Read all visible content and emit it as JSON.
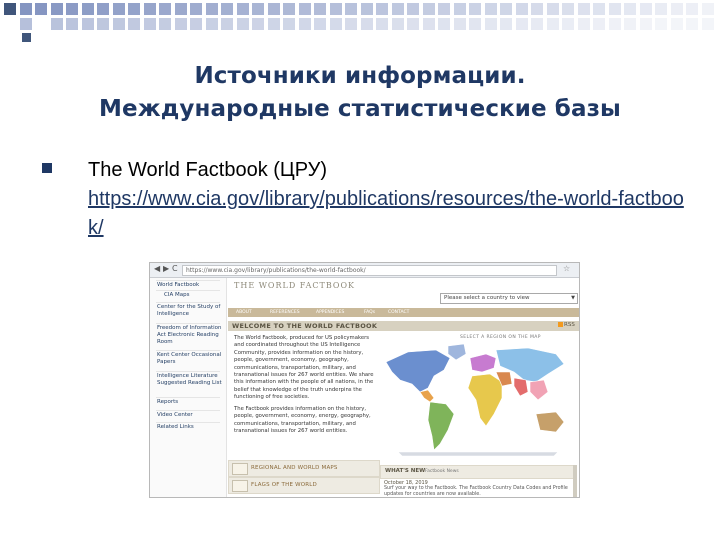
{
  "slide": {
    "title_line1": "Источники информации.",
    "title_line2": "Международные статистические базы",
    "bullet_text": "The World Factbook (ЦРУ)",
    "bullet_link": "https://www.cia.gov/library/publications/resources/the-world-factbook/",
    "accent_color": "#1f3864"
  },
  "screenshot": {
    "url": "https://www.cia.gov/library/publications/the-world-factbook/",
    "sidebar": [
      "World Factbook",
      "CIA Maps",
      "Center for the Study of Intelligence",
      "Freedom of Information Act Electronic Reading Room",
      "Kent Center Occasional Papers",
      "Intelligence Literature Suggested Reading List",
      "Reports",
      "Video Center",
      "Related Links"
    ],
    "header_title": "THE WORLD FACTBOOK",
    "country_select": "Please select a country to view",
    "tabs": [
      "ABOUT",
      "REFERENCES",
      "APPENDICES",
      "FAQs",
      "CONTACT"
    ],
    "welcome_title": "WELCOME TO THE WORLD FACTBOOK",
    "rss": "RSS",
    "map_hint": "SELECT A REGION ON THE MAP",
    "paragraph1": "The World Factbook, produced for US policymakers and coordinated throughout the US Intelligence Community, provides information on the history, people, government, economy, geography, communications, transportation, military, and transnational issues for 267 world entities. We share this information with the people of all nations, in the belief that knowledge of the truth underpins the functioning of free societies.",
    "paragraph2": "The Factbook provides information on the history, people, government, economy, energy, geography, communications, transportation, military, and transnational issues for 267 world entities.",
    "panels": [
      "REGIONAL AND WORLD MAPS",
      "FLAGS OF THE WORLD"
    ],
    "news_title": "WHAT'S NEW",
    "news_sub": "Factbook News",
    "news_date": "October 18, 2019",
    "news_text": "Surf your way to the Factbook. The Factbook Country Data Codes and Profile updates for countries are now available."
  }
}
